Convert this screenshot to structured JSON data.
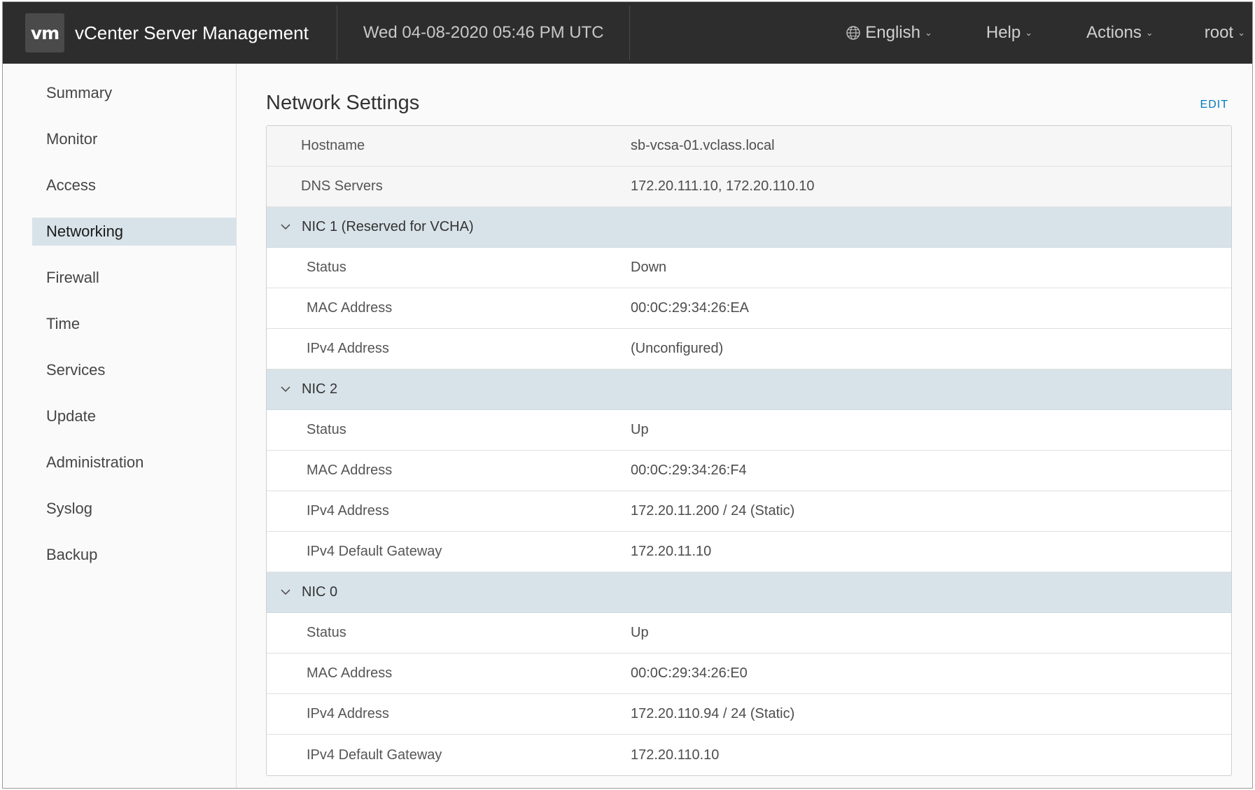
{
  "header": {
    "logo_text": "vm",
    "app_title": "vCenter Server Management",
    "datetime": "Wed 04-08-2020 05:46 PM UTC",
    "menus": {
      "language": "English",
      "help": "Help",
      "actions": "Actions",
      "user": "root"
    }
  },
  "sidebar": {
    "items": [
      {
        "label": "Summary"
      },
      {
        "label": "Monitor"
      },
      {
        "label": "Access"
      },
      {
        "label": "Networking",
        "active": true
      },
      {
        "label": "Firewall"
      },
      {
        "label": "Time"
      },
      {
        "label": "Services"
      },
      {
        "label": "Update"
      },
      {
        "label": "Administration"
      },
      {
        "label": "Syslog"
      },
      {
        "label": "Backup"
      }
    ]
  },
  "main": {
    "title": "Network Settings",
    "edit_label": "EDIT",
    "general": [
      {
        "label": "Hostname",
        "value": "sb-vcsa-01.vclass.local"
      },
      {
        "label": "DNS Servers",
        "value": "172.20.111.10, 172.20.110.10"
      }
    ],
    "nics": [
      {
        "name": "NIC 1 (Reserved for VCHA)",
        "rows": [
          {
            "label": "Status",
            "value": "Down"
          },
          {
            "label": "MAC Address",
            "value": "00:0C:29:34:26:EA"
          },
          {
            "label": "IPv4 Address",
            "value": "(Unconfigured)"
          }
        ]
      },
      {
        "name": "NIC 2",
        "rows": [
          {
            "label": "Status",
            "value": "Up"
          },
          {
            "label": "MAC Address",
            "value": "00:0C:29:34:26:F4"
          },
          {
            "label": "IPv4 Address",
            "value": "172.20.11.200 / 24 (Static)"
          },
          {
            "label": "IPv4 Default Gateway",
            "value": "172.20.11.10"
          }
        ]
      },
      {
        "name": "NIC 0",
        "rows": [
          {
            "label": "Status",
            "value": "Up"
          },
          {
            "label": "MAC Address",
            "value": "00:0C:29:34:26:E0"
          },
          {
            "label": "IPv4 Address",
            "value": "172.20.110.94 / 24 (Static)"
          },
          {
            "label": "IPv4 Default Gateway",
            "value": "172.20.110.10"
          }
        ]
      }
    ]
  },
  "icons": {
    "language": "globe-icon",
    "dropdown": "chevron-down-icon",
    "section_toggle": "chevron-down-icon"
  },
  "colors": {
    "header_bg": "#2d2d2d",
    "active_nav_bg": "#d8e3e9",
    "section_bg": "#d8e3e9",
    "link": "#0079b8"
  }
}
